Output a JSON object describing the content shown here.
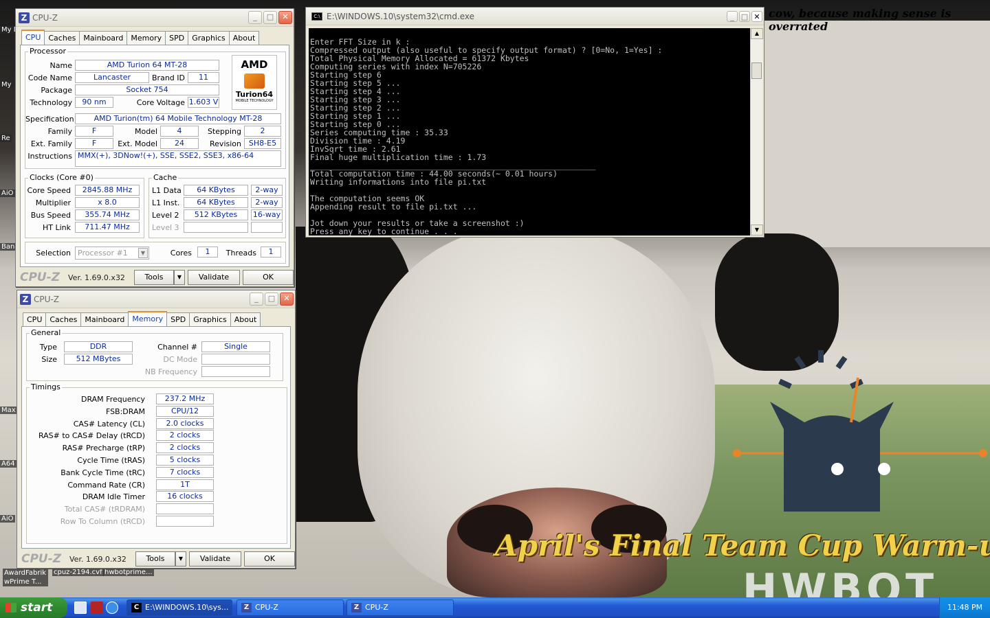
{
  "desktop": {
    "caption": "cow, because making sense is overrated",
    "banner": "April's Final Team Cup Warm-up",
    "watermark": "HWBOT",
    "side_icons": [
      "My D",
      "My",
      "Re",
      "AiO",
      "Ban",
      "Max",
      "A64",
      "AiO"
    ],
    "bottom_icons": [
      "AwardFabrik wPrime T...",
      "cpuz-2194.cvf",
      "hwbotprime..."
    ]
  },
  "cpuz_cpu": {
    "title": "CPU-Z",
    "tabs": [
      "CPU",
      "Caches",
      "Mainboard",
      "Memory",
      "SPD",
      "Graphics",
      "About"
    ],
    "active_tab": "CPU",
    "processor": {
      "group": "Processor",
      "name_label": "Name",
      "name": "AMD Turion 64 MT-28",
      "codename_label": "Code Name",
      "codename": "Lancaster",
      "brandid_label": "Brand ID",
      "brandid": "11",
      "package_label": "Package",
      "package": "Socket 754",
      "tech_label": "Technology",
      "tech": "90 nm",
      "voltage_label": "Core Voltage",
      "voltage": "1.603 V",
      "spec_label": "Specification",
      "spec": "AMD Turion(tm) 64 Mobile Technology MT-28",
      "family_label": "Family",
      "family": "F",
      "model_label": "Model",
      "model": "4",
      "stepping_label": "Stepping",
      "stepping": "2",
      "extfamily_label": "Ext. Family",
      "extfamily": "F",
      "extmodel_label": "Ext. Model",
      "extmodel": "24",
      "revision_label": "Revision",
      "revision": "SH8-E5",
      "instr_label": "Instructions",
      "instr": "MMX(+), 3DNow!(+), SSE, SSE2, SSE3, x86-64",
      "logo_top": "AMD",
      "logo_brand": "Turion64",
      "logo_sub": "MOBILE TECHNOLOGY"
    },
    "clocks": {
      "group": "Clocks (Core #0)",
      "speed_label": "Core Speed",
      "speed": "2845.88 MHz",
      "mult_label": "Multiplier",
      "mult": "x 8.0",
      "bus_label": "Bus Speed",
      "bus": "355.74 MHz",
      "ht_label": "HT Link",
      "ht": "711.47 MHz"
    },
    "cache": {
      "group": "Cache",
      "l1d_label": "L1 Data",
      "l1d": "64 KBytes",
      "l1d_way": "2-way",
      "l1i_label": "L1 Inst.",
      "l1i": "64 KBytes",
      "l1i_way": "2-way",
      "l2_label": "Level 2",
      "l2": "512 KBytes",
      "l2_way": "16-way",
      "l3_label": "Level 3"
    },
    "selection_label": "Selection",
    "selection": "Processor #1",
    "cores_label": "Cores",
    "cores": "1",
    "threads_label": "Threads",
    "threads": "1",
    "footer": {
      "brand": "CPU-Z",
      "version": "Ver. 1.69.0.x32",
      "tools": "Tools",
      "validate": "Validate",
      "ok": "OK"
    }
  },
  "cpuz_mem": {
    "title": "CPU-Z",
    "tabs": [
      "CPU",
      "Caches",
      "Mainboard",
      "Memory",
      "SPD",
      "Graphics",
      "About"
    ],
    "active_tab": "Memory",
    "general": {
      "group": "General",
      "type_label": "Type",
      "type": "DDR",
      "size_label": "Size",
      "size": "512 MBytes",
      "channel_label": "Channel #",
      "channel": "Single",
      "dcmode_label": "DC Mode",
      "nbfreq_label": "NB Frequency"
    },
    "timings": {
      "group": "Timings",
      "rows": [
        {
          "label": "DRAM Frequency",
          "value": "237.2 MHz"
        },
        {
          "label": "FSB:DRAM",
          "value": "CPU/12"
        },
        {
          "label": "CAS# Latency (CL)",
          "value": "2.0 clocks"
        },
        {
          "label": "RAS# to CAS# Delay (tRCD)",
          "value": "2 clocks"
        },
        {
          "label": "RAS# Precharge (tRP)",
          "value": "2 clocks"
        },
        {
          "label": "Cycle Time (tRAS)",
          "value": "5 clocks"
        },
        {
          "label": "Bank Cycle Time (tRC)",
          "value": "7 clocks"
        },
        {
          "label": "Command Rate (CR)",
          "value": "1T"
        },
        {
          "label": "DRAM Idle Timer",
          "value": "16 clocks"
        },
        {
          "label": "Total CAS# (tRDRAM)",
          "value": ""
        },
        {
          "label": "Row To Column (tRCD)",
          "value": ""
        }
      ]
    },
    "footer": {
      "brand": "CPU-Z",
      "version": "Ver. 1.69.0.x32",
      "tools": "Tools",
      "validate": "Validate",
      "ok": "OK"
    }
  },
  "cmd": {
    "title": "E:\\WINDOWS.10\\system32\\cmd.exe",
    "lines": [
      "Enter FFT Size in k :",
      "Compressed output (also useful to specify output format) ? [0=No, 1=Yes] :",
      "Total Physical Memory Allocated = 61372 Kbytes",
      "Computing series with index N=705226",
      "Starting step 6",
      "Starting step 5 ...",
      "Starting step 4 ...",
      "Starting step 3 ...",
      "Starting step 2 ...",
      "Starting step 1 ...",
      "Starting step 0 ...",
      "Series computing time : 35.33",
      "Division time : 4.19",
      "InvSqrt time : 2.61",
      "Final huge multiplication time : 1.73",
      "____________________________________________________________",
      "Total computation time : 44.00 seconds(~ 0.01 hours)",
      "Writing informations into file pi.txt",
      "",
      "The computation seems OK",
      "Appending result to file pi.txt ...",
      "",
      "Jot down your results or take a screenshot :)",
      "Press any key to continue . . ."
    ]
  },
  "taskbar": {
    "start": "start",
    "tasks": [
      "E:\\WINDOWS.10\\sys...",
      "CPU-Z",
      "CPU-Z"
    ],
    "clock": "11:48 PM"
  }
}
